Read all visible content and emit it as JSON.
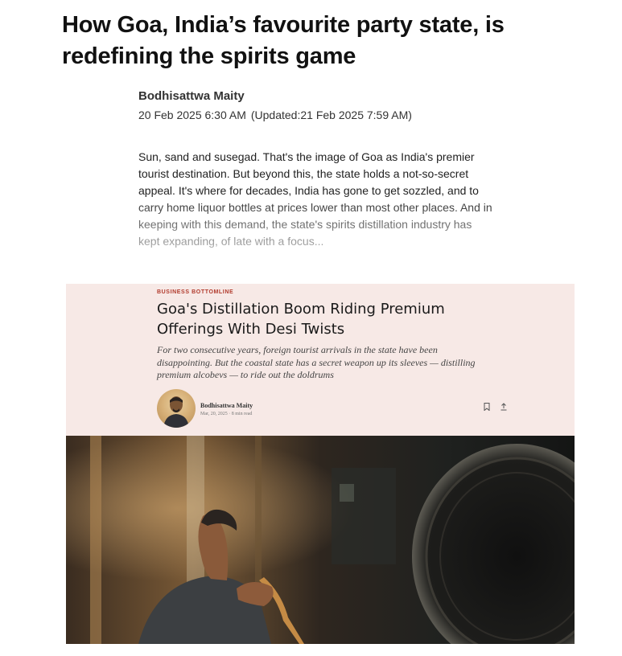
{
  "article": {
    "headline": "How Goa, India’s favourite party state, is redefining the spirits game",
    "author": "Bodhisattwa Maity",
    "published": "20 Feb 2025 6:30 AM",
    "updated": "(Updated:21 Feb 2025 7:59 AM)",
    "summary": "Sun, sand and susegad. That's the image of Goa as India's premier tourist destination. But beyond this, the state holds a not-so-secret appeal. It's where for decades, India has gone to get sozzled, and to carry home liquor bottles at prices lower than most other places. And in keeping with this demand, the state's spirits distillation industry has kept expanding, of late with a focus..."
  },
  "card": {
    "kicker": "BUSINESS BOTTOMLINE",
    "title": "Goa's Distillation Boom Riding Premium Offerings With Desi Twists",
    "deck": "For two consecutive years, foreign tourist arrivals in the state have been disappointing. But the coastal state has a secret weapon up its sleeves — distilling premium alcobevs — to ride out the doldrums",
    "author": "Bodhisattwa Maity",
    "meta": "Mar, 20, 2025 · 8 min read"
  },
  "icons": {
    "bookmark": "bookmark-icon",
    "share": "share-icon"
  },
  "colors": {
    "card_background": "#f7e9e6",
    "kicker": "#b13a2c"
  }
}
